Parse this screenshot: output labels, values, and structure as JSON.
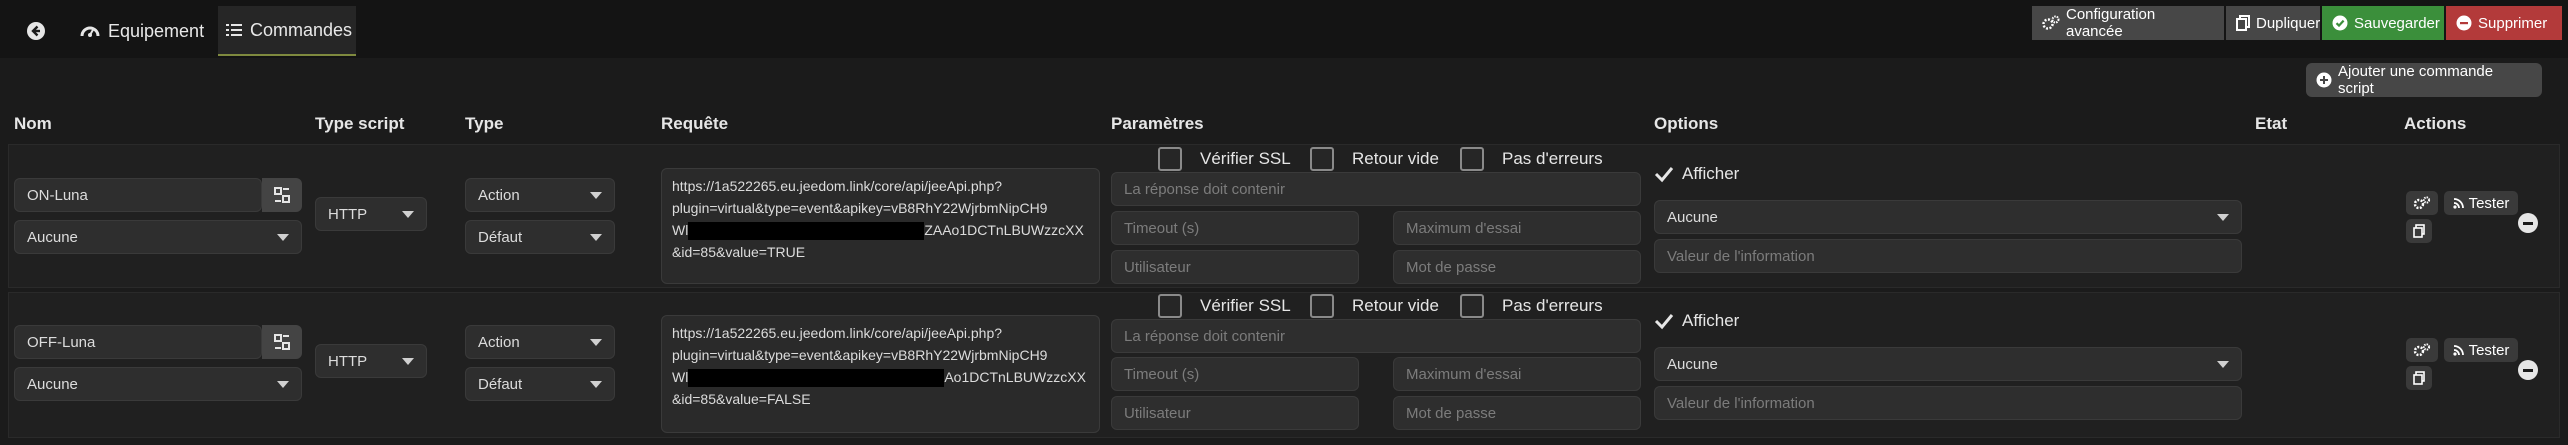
{
  "tabs": {
    "back_icon": "arrow-left-icon",
    "equipement": {
      "label": "Equipement",
      "icon": "gauge-icon"
    },
    "commandes": {
      "label": "Commandes",
      "icon": "list-icon"
    }
  },
  "toolbar": {
    "config_label": "Configuration avancée",
    "dupliquer_label": "Dupliquer",
    "sauvegarder_label": "Sauvegarder",
    "supprimer_label": "Supprimer"
  },
  "add_command_label": "Ajouter une commande script",
  "columns": [
    "Nom",
    "Type script",
    "Type",
    "Requête",
    "Paramètres",
    "Options",
    "Etat",
    "Actions"
  ],
  "common": {
    "verifier_ssl": "Vérifier SSL",
    "retour_vide": "Retour vide",
    "pas_erreurs": "Pas d'erreurs",
    "reponse_placeholder": "La réponse doit contenir",
    "timeout_placeholder": "Timeout (s)",
    "max_essai_placeholder": "Maximum d'essai",
    "utilisateur_placeholder": "Utilisateur",
    "mot_de_passe_placeholder": "Mot de passe",
    "afficher": "Afficher",
    "valeur_placeholder": "Valeur de l'information",
    "tester": "Tester"
  },
  "rows": [
    {
      "name": "ON-Luna",
      "parent": "Aucune",
      "script_type": "HTTP",
      "type": "Action",
      "subtype": "Défaut",
      "request_line1": "https://1a522265.eu.jeedom.link/core/api/jeeApi.php?",
      "request_line2": "plugin=virtual&type=event&apikey=vB8RhY22WjrbmNipCH9",
      "request_line3_start": "Wl",
      "request_line3_end": "ZAAo1DCTnLBUWzzcXX",
      "request_line4": "&id=85&value=TRUE",
      "option_select": "Aucune"
    },
    {
      "name": "OFF-Luna",
      "parent": "Aucune",
      "script_type": "HTTP",
      "type": "Action",
      "subtype": "Défaut",
      "request_line1": "https://1a522265.eu.jeedom.link/core/api/jeeApi.php?",
      "request_line2": "plugin=virtual&type=event&apikey=vB8RhY22WjrbmNipCH9",
      "request_line3_start": "Wl",
      "request_line3_end": "Ao1DCTnLBUWzzcXX",
      "request_line4": "&id=85&value=FALSE",
      "option_select": "Aucune"
    }
  ]
}
